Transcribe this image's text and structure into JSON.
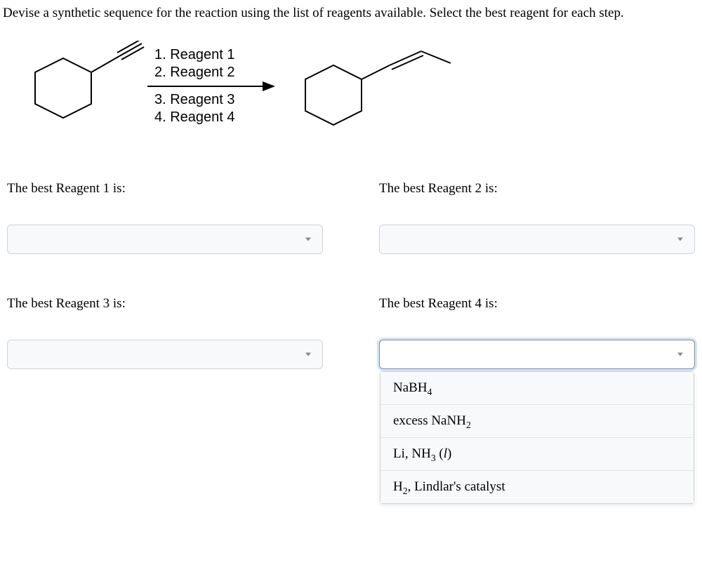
{
  "question": "Devise a synthetic sequence for the reaction using the list of reagents available. Select the best reagent for each step.",
  "reagent_lines": {
    "line1": "1. Reagent 1",
    "line2": "2. Reagent 2",
    "line3": "3. Reagent 3",
    "line4": "4. Reagent 4"
  },
  "prompts": {
    "r1": "The best Reagent 1 is:",
    "r2": "The best Reagent 2 is:",
    "r3": "The best Reagent 3 is:",
    "r4": "The best Reagent 4 is:"
  },
  "dropdown_options": [
    {
      "display_html": "NaBH<span class='sub'>4</span>",
      "raw": "NaBH4"
    },
    {
      "display_html": "excess NaNH<span class='sub'>2</span>",
      "raw": "excess NaNH2"
    },
    {
      "display_html": "Li, NH<span class='sub'>3</span> (<span class='ital'>l</span>)",
      "raw": "Li, NH3 (l)"
    },
    {
      "display_html": "H<span class='sub'>2</span>, Lindlar's catalyst",
      "raw": "H2, Lindlar's catalyst"
    }
  ]
}
